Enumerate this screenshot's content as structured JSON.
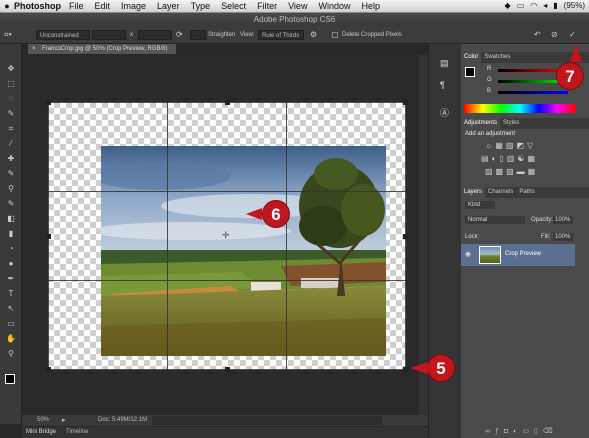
{
  "menubar": {
    "apple": "",
    "app": "Photoshop",
    "items": [
      "File",
      "Edit",
      "Image",
      "Layer",
      "Type",
      "Select",
      "Filter",
      "View",
      "Window",
      "Help"
    ],
    "battery": "(95%)"
  },
  "title": "Adobe Photoshop CS6",
  "options": {
    "ratio": "Unconstrained",
    "x": "x",
    "straighten": "Straighten",
    "view_label": "View:",
    "view_value": "Rule of Thirds",
    "delete_cropped": "Delete Cropped Pixels"
  },
  "document_tab": "FrancoCrop.jpg @ 50% (Crop Preview, RGB/8)",
  "status": {
    "zoom": "50%",
    "doc": "Doc: 5.49M/12.1M"
  },
  "bottom_tabs": [
    "Mini Bridge",
    "Timeline"
  ],
  "panels": {
    "color_tabs": [
      "Color",
      "Swatches"
    ],
    "slider_labels": [
      "R",
      "G",
      "B"
    ],
    "adjust_tabs": [
      "Adjustments",
      "Styles"
    ],
    "adjust_title": "Add an adjustment",
    "layer_tabs": [
      "Layers",
      "Channels",
      "Paths"
    ],
    "kind": "Kind",
    "blend": "Normal",
    "opacity_label": "Opacity:",
    "opacity": "100%",
    "lock_label": "Lock:",
    "fill_label": "Fill:",
    "fill": "100%",
    "layer_name": "Crop Preview"
  },
  "callouts": [
    "5",
    "6",
    "7"
  ],
  "colors": {
    "callout": "#c0161d",
    "panel_bg": "#4a4a4a"
  }
}
